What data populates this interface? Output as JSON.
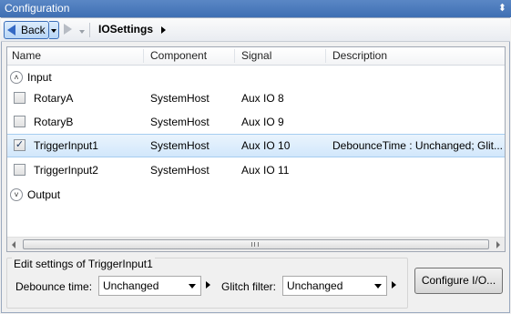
{
  "window": {
    "title": "Configuration",
    "pin_glyph": "⬍"
  },
  "toolbar": {
    "back_label": "Back",
    "breadcrumb": "IOSettings"
  },
  "table": {
    "columns": [
      "Name",
      "Component",
      "Signal",
      "Description"
    ],
    "groups": [
      {
        "label": "Input",
        "expand_glyph": "˄"
      },
      {
        "label": "Output",
        "expand_glyph": "˅"
      }
    ],
    "rows": [
      {
        "name": "RotaryA",
        "component": "SystemHost",
        "signal": "Aux IO 8",
        "description": "",
        "checked": false,
        "check_glyph": ""
      },
      {
        "name": "RotaryB",
        "component": "SystemHost",
        "signal": "Aux IO 9",
        "description": "",
        "checked": false,
        "check_glyph": ""
      },
      {
        "name": "TriggerInput1",
        "component": "SystemHost",
        "signal": "Aux IO 10",
        "description": "DebounceTime : Unchanged; Glit...",
        "checked": true,
        "check_glyph": "✓"
      },
      {
        "name": "TriggerInput2",
        "component": "SystemHost",
        "signal": "Aux IO 11",
        "description": "",
        "checked": false,
        "check_glyph": ""
      }
    ],
    "selected_row": "TriggerInput1"
  },
  "edit_settings": {
    "legend": "Edit settings of TriggerInput1",
    "debounce_label": "Debounce time:",
    "debounce_value": "Unchanged",
    "glitch_label": "Glitch filter:",
    "glitch_value": "Unchanged"
  },
  "configure_button": "Configure I/O...",
  "colors": {
    "titlebar": "#4a7bbd",
    "selection": "#d2e7fb",
    "accent": "#3469c4"
  }
}
